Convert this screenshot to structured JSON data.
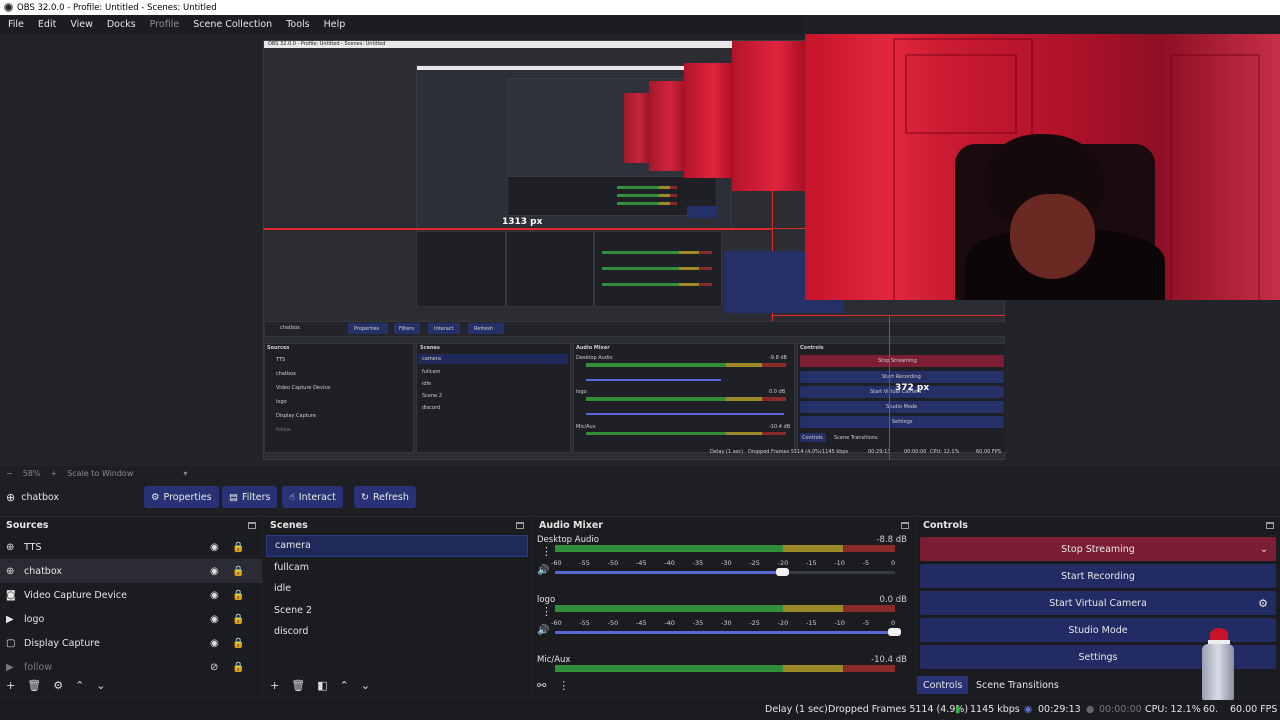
{
  "window": {
    "title": "OBS 32.0.0 - Profile: Untitled - Scenes: Untitled"
  },
  "menu": [
    "File",
    "Edit",
    "View",
    "Docks",
    "Profile",
    "Scene Collection",
    "Tools",
    "Help"
  ],
  "preview": {
    "guide_horizontal": "1313 px",
    "guide_vertical": "372 px",
    "zoom": "58%",
    "scale_mode": "Scale to Window",
    "nested_labels": {
      "title": "OBS 32.0.0 - Profile: Untitled - Scenes: Untitled",
      "source": "chatbox",
      "toolbar": [
        "Properties",
        "Filters",
        "Interact",
        "Refresh"
      ],
      "docks": [
        "Sources",
        "Scenes",
        "Audio Mixer",
        "Controls"
      ],
      "sources": [
        "TTS",
        "chatbox",
        "Video Capture Device",
        "logo",
        "Display Capture",
        "follow"
      ],
      "scenes": [
        "camera",
        "fullcam",
        "idle",
        "Scene 2",
        "discord"
      ],
      "mixer": [
        {
          "name": "Desktop Audio",
          "db": "-9.8 dB"
        },
        {
          "name": "logo",
          "db": "0.0 dB"
        },
        {
          "name": "Mic/Aux",
          "db": "-10.4 dB"
        }
      ],
      "controls": [
        "Stop Streaming",
        "Start Recording",
        "Start Virtual Camera",
        "Studio Mode",
        "Settings"
      ],
      "tabs": [
        "Controls",
        "Scene Transitions"
      ],
      "status": [
        "Delay (1 sec)",
        "Dropped Frames 5114 (4.0%)",
        "1145 kbps",
        "00:29:13",
        "00:00:00",
        "CPU: 12.1%",
        "60.00 FPS"
      ]
    }
  },
  "source_toolbar": {
    "selected_source": "chatbox",
    "properties": "Properties",
    "filters": "Filters",
    "interact": "Interact",
    "refresh": "Refresh"
  },
  "sources": {
    "title": "Sources",
    "items": [
      {
        "name": "TTS",
        "icon": "globe-icon",
        "hidden": false
      },
      {
        "name": "chatbox",
        "icon": "globe-icon",
        "hidden": false,
        "selected": true
      },
      {
        "name": "Video Capture Device",
        "icon": "camera-icon",
        "hidden": false
      },
      {
        "name": "logo",
        "icon": "media-play-icon",
        "hidden": false
      },
      {
        "name": "Display Capture",
        "icon": "monitor-icon",
        "hidden": false
      },
      {
        "name": "follow",
        "icon": "media-play-icon",
        "hidden": true
      }
    ]
  },
  "scenes": {
    "title": "Scenes",
    "items": [
      "camera",
      "fullcam",
      "idle",
      "Scene 2",
      "discord"
    ],
    "selected": "camera"
  },
  "mixer": {
    "title": "Audio Mixer",
    "tick_labels": [
      "-60",
      "-55",
      "-50",
      "-45",
      "-40",
      "-35",
      "-30",
      "-25",
      "-20",
      "-15",
      "-10",
      "-5",
      "0"
    ],
    "channels": [
      {
        "name": "Desktop Audio",
        "db": "-8.8 dB",
        "volume": 0.67
      },
      {
        "name": "logo",
        "db": "0.0 dB",
        "volume": 1.0
      },
      {
        "name": "Mic/Aux",
        "db": "-10.4 dB",
        "volume": 0.79
      }
    ]
  },
  "controls": {
    "title": "Controls",
    "stop_streaming": "Stop Streaming",
    "start_recording": "Start Recording",
    "start_virtual_camera": "Start Virtual Camera",
    "studio_mode": "Studio Mode",
    "settings": "Settings",
    "tabs": [
      "Controls",
      "Scene Transitions"
    ]
  },
  "status": {
    "delay": "Delay (1 sec)",
    "dropped_frames": "Dropped Frames 5114 (4.9%)",
    "bitrate": "1145 kbps",
    "stream_time": "00:29:13",
    "record_time": "00:00:00",
    "cpu": "CPU: 12.1%",
    "fps_partial": "60.",
    "fps": "60.00 FPS"
  },
  "colors": {
    "accent": "#283274",
    "stop": "#7b1e33",
    "meter_green": "#2f8f3a",
    "meter_yellow": "#9a8a2a",
    "meter_red": "#8a2a2a",
    "guide_red": "#e22a2a"
  }
}
